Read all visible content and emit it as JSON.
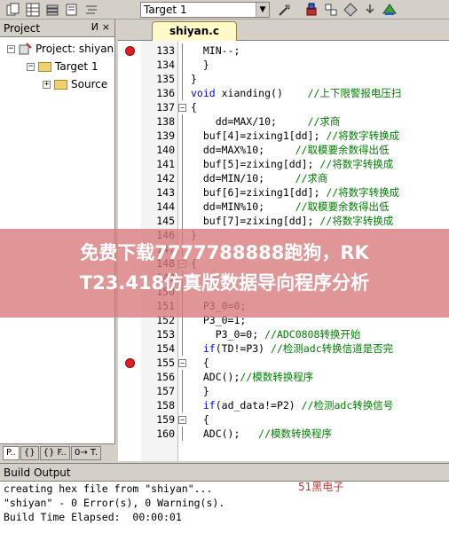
{
  "toolbar": {
    "target_select": "Target 1",
    "icons": [
      "copy-icon",
      "grid-icon",
      "stack-icon",
      "book-icon",
      "align-icon",
      "build-icon",
      "download-icon",
      "options-icon",
      "manage-icon",
      "diamond-icon",
      "books-icon"
    ]
  },
  "project": {
    "title": "Project",
    "pin": "И",
    "close": "×",
    "tree": [
      "Project: shiyan",
      "Target 1",
      "Source"
    ],
    "tabs": [
      "P..",
      "{}",
      "{} F..",
      "0→ T."
    ]
  },
  "editor": {
    "tab": "shiyan.c",
    "lines": [
      {
        "n": "133",
        "code": "  MIN--;"
      },
      {
        "n": "134",
        "code": "  }"
      },
      {
        "n": "135",
        "code": "}"
      },
      {
        "n": "136",
        "code": "void xianding()    //上下限警报电压扫"
      },
      {
        "n": "137",
        "code": "{"
      },
      {
        "n": "138",
        "code": "    dd=MAX/10;     //求商"
      },
      {
        "n": "139",
        "code": "  buf[4]=zixing1[dd]; //将数字转换成"
      },
      {
        "n": "140",
        "code": "  dd=MAX%10;     //取模要余数得出低"
      },
      {
        "n": "141",
        "code": "  buf[5]=zixing[dd]; //将数字转换成"
      },
      {
        "n": "142",
        "code": "  dd=MIN/10;     //求商"
      },
      {
        "n": "143",
        "code": "  buf[6]=zixing1[dd]; //将数字转换成"
      },
      {
        "n": "144",
        "code": "  dd=MIN%10;     //取模要余数得出低"
      },
      {
        "n": "145",
        "code": "  buf[7]=zixing[dd]; //将数字转换成"
      },
      {
        "n": "146",
        "code": "}"
      },
      {
        "n": "147",
        "code": ""
      },
      {
        "n": "148",
        "code": "{"
      },
      {
        "n": "149",
        "code": ""
      },
      {
        "n": "150",
        "code": ""
      },
      {
        "n": "151",
        "code": "  P3_0=0;"
      },
      {
        "n": "152",
        "code": "  P3_0=1;"
      },
      {
        "n": "153",
        "code": "    P3_0=0; //ADC0808转换开始"
      },
      {
        "n": "154",
        "code": "  if(TD!=P3) //检测adc转换信道是否完"
      },
      {
        "n": "155",
        "code": "  {"
      },
      {
        "n": "156",
        "code": "  ADC();//模数转换程序"
      },
      {
        "n": "157",
        "code": "  }"
      },
      {
        "n": "158",
        "code": "  if(ad_data!=P2) //检测adc转换信号"
      },
      {
        "n": "159",
        "code": "  {"
      },
      {
        "n": "160",
        "code": "  ADC();   //模数转换程序"
      }
    ]
  },
  "watermark": {
    "line1": "免费下载7777788888跑狗，RK",
    "line2": "T23.418仿真版数据导向程序分析"
  },
  "build": {
    "title": "Build Output",
    "lines": [
      "creating hex file from \"shiyan\"...",
      "\"shiyan\" - 0 Error(s), 0 Warning(s).",
      "Build Time Elapsed:  00:00:01"
    ],
    "stamp": "51黑电子"
  },
  "colors": {
    "tab_bg": "#fff9c8",
    "comment": "#008000",
    "keyword": "#0000ff",
    "breakpoint": "#e02020",
    "banner": "#d77878"
  }
}
